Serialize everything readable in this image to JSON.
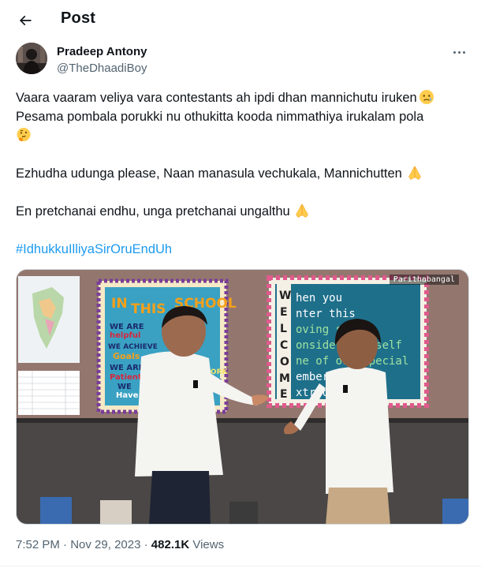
{
  "header": {
    "title": "Post",
    "back_icon": "arrow-left-icon"
  },
  "author": {
    "name": "Pradeep Antony",
    "handle": "@TheDhaadiBoy",
    "more_icon": "more-horizontal-icon"
  },
  "tweet": {
    "lines": [
      "Vaara vaaram veliya vara contestants ah ipdi dhan mannichutu iruken",
      "Pesama pombala porukki nu othukitta kooda nimmathiya irukalam pola",
      "",
      "Ezhudha udunga please, Naan manasula vechukala, Mannichutten",
      "",
      "En pretchanai endhu, unga pretchanai ungalthu"
    ],
    "emojis": {
      "line1": "crying-face-icon",
      "line2": "thinking-face-icon",
      "line4": "folded-hands-icon",
      "line6": "folded-hands-icon"
    },
    "hashtag": "#IdhukkuIlliyaSirOruEndUh"
  },
  "media": {
    "description_icon": "video-thumbnail",
    "watermark": "Parithabangal",
    "board_welcome_text": [
      "When you",
      "enter this",
      "loving school",
      "consider yourself",
      "one of our special",
      "members",
      "extraordinary"
    ],
    "board_school_text": [
      "IN THIS",
      "SCHOOL",
      "WE ARE",
      "helpful",
      "WE ACHIEVE",
      "Goals",
      "WE ARE",
      "Patient",
      "WE",
      "Have",
      "FUN"
    ],
    "map_title": "India Political Map"
  },
  "meta": {
    "time": "7:52 PM",
    "separator1": " · ",
    "date": "Nov 29, 2023",
    "separator2": " · ",
    "views_count": "482.1K",
    "views_label": " Views"
  },
  "colors": {
    "text": "#0f1419",
    "secondary": "#536471",
    "link": "#1d9bf0",
    "border": "#cfd9de"
  }
}
